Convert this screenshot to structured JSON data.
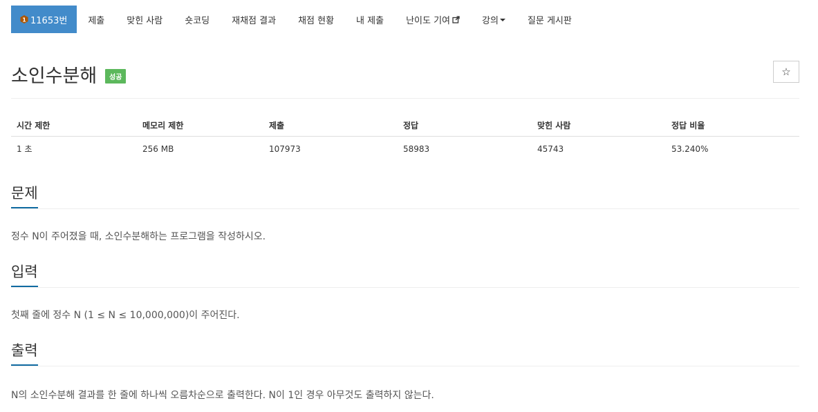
{
  "nav": {
    "problem_number": "11653번",
    "items": [
      "제출",
      "맞힌 사람",
      "숏코딩",
      "재채점 결과",
      "채점 현황",
      "내 제출",
      "난이도 기여",
      "강의",
      "질문 게시판"
    ]
  },
  "problem": {
    "title": "소인수분해",
    "status_badge": "성공",
    "star_icon": "☆"
  },
  "info_table": {
    "headers": [
      "시간 제한",
      "메모리 제한",
      "제출",
      "정답",
      "맞힌 사람",
      "정답 비율"
    ],
    "values": [
      "1 초",
      "256 MB",
      "107973",
      "58983",
      "45743",
      "53.240%"
    ]
  },
  "sections": {
    "description": {
      "heading": "문제",
      "text": "정수 N이 주어졌을 때, 소인수분해하는 프로그램을 작성하시오."
    },
    "input": {
      "heading": "입력",
      "text": "첫째 줄에 정수 N (1 ≤ N ≤ 10,000,000)이 주어진다."
    },
    "output": {
      "heading": "출력",
      "text": "N의 소인수분해 결과를 한 줄에 하나씩 오름차순으로 출력한다. N이 1인 경우 아무것도 출력하지 않는다."
    }
  },
  "colors": {
    "nav_active": "#428bca",
    "badge_success": "#5cb85c",
    "section_underline": "#0f6aa1"
  }
}
